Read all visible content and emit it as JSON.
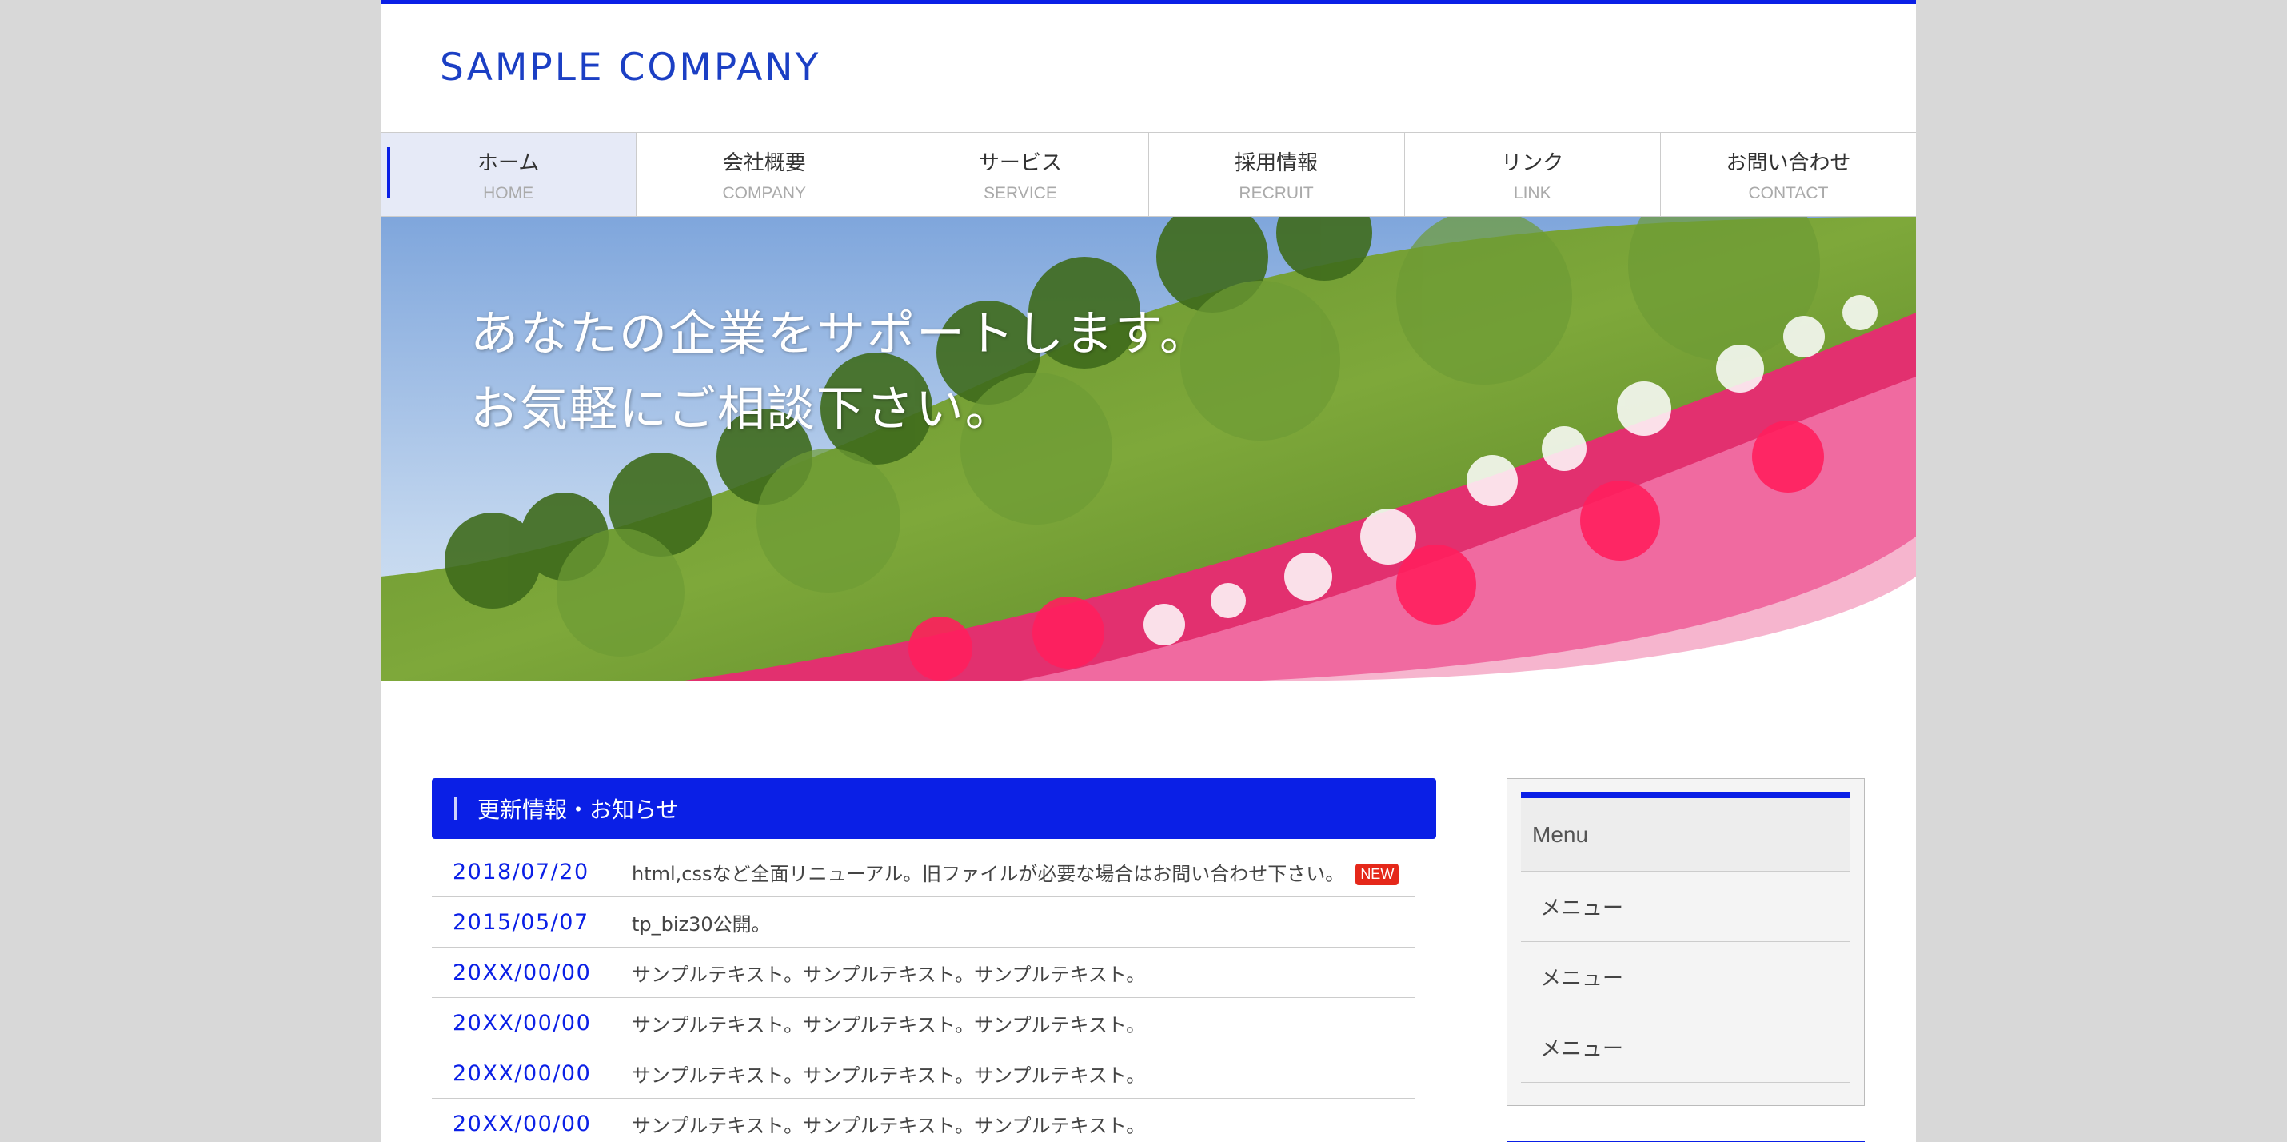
{
  "header": {
    "logo": "SAMPLE COMPANY"
  },
  "nav": [
    {
      "jp": "ホーム",
      "en": "HOME",
      "active": true
    },
    {
      "jp": "会社概要",
      "en": "COMPANY"
    },
    {
      "jp": "サービス",
      "en": "SERVICE"
    },
    {
      "jp": "採用情報",
      "en": "RECRUIT"
    },
    {
      "jp": "リンク",
      "en": "LINK"
    },
    {
      "jp": "お問い合わせ",
      "en": "CONTACT"
    }
  ],
  "hero": {
    "line1": "あなたの企業をサポートします。",
    "line2": "お気軽にご相談下さい。"
  },
  "news": {
    "heading": "更新情報・お知らせ",
    "items": [
      {
        "date": "2018/07/20",
        "text": "html,cssなど全面リニューアル。旧ファイルが必要な場合はお問い合わせ下さい。",
        "badge": "NEW"
      },
      {
        "date": "2015/05/07",
        "text": "tp_biz30公開。"
      },
      {
        "date": "20XX/00/00",
        "text": "サンプルテキスト。サンプルテキスト。サンプルテキスト。"
      },
      {
        "date": "20XX/00/00",
        "text": "サンプルテキスト。サンプルテキスト。サンプルテキスト。"
      },
      {
        "date": "20XX/00/00",
        "text": "サンプルテキスト。サンプルテキスト。サンプルテキスト。"
      },
      {
        "date": "20XX/00/00",
        "text": "サンプルテキスト。サンプルテキスト。サンプルテキスト。"
      }
    ]
  },
  "sidebar": {
    "title": "Menu",
    "items": [
      "メニュー",
      "メニュー",
      "メニュー"
    ]
  },
  "colors": {
    "accent": "#0a1fe6",
    "logo": "#1b3fc4",
    "badge": "#e5281a"
  }
}
